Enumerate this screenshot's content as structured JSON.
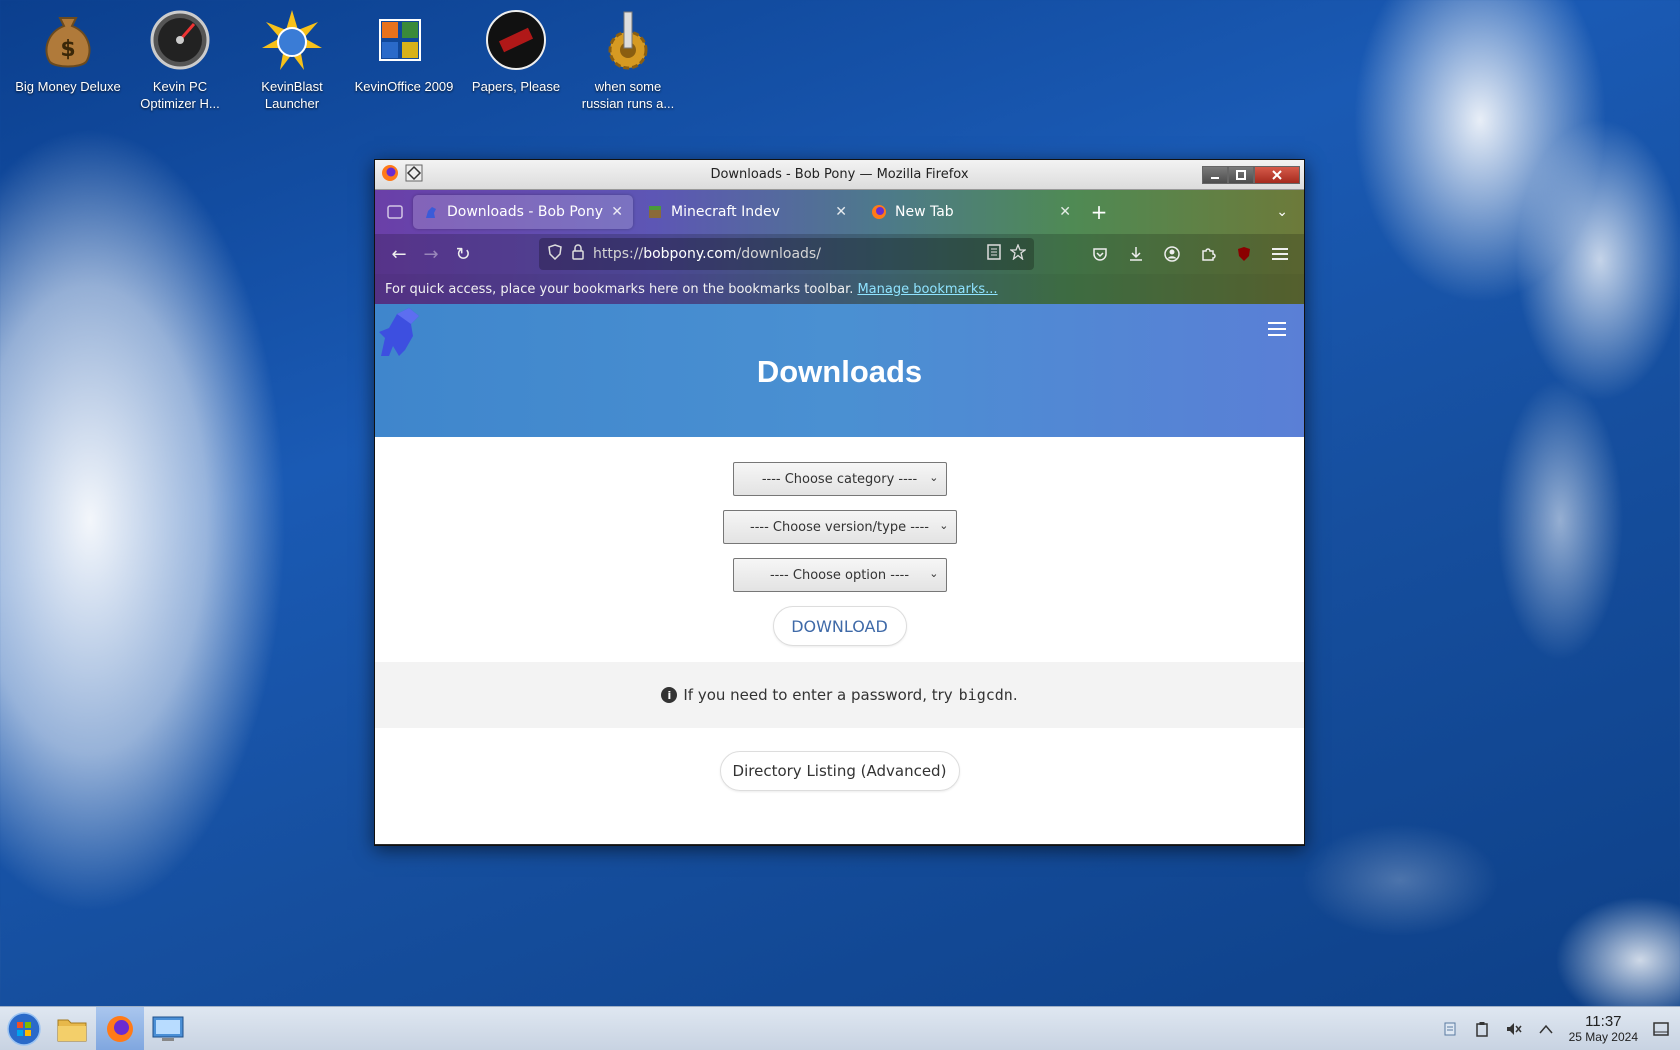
{
  "desktop": {
    "icons": [
      {
        "label": "Big Money Deluxe",
        "icon": "money-bag-icon"
      },
      {
        "label": "Kevin PC Optimizer H...",
        "icon": "speedometer-icon"
      },
      {
        "label": "KevinBlast Launcher",
        "icon": "blast-globe-icon"
      },
      {
        "label": "KevinOffice 2009",
        "icon": "office-icon"
      },
      {
        "label": "Papers, Please",
        "icon": "papers-please-icon"
      },
      {
        "label": "when some russian runs a...",
        "icon": "gear-icon"
      }
    ]
  },
  "window": {
    "title": "Downloads - Bob Pony — Mozilla Firefox",
    "tabs": [
      {
        "label": "Downloads - Bob Pony",
        "active": true
      },
      {
        "label": "Minecraft Indev",
        "active": false
      },
      {
        "label": "New Tab",
        "active": false
      }
    ],
    "url": {
      "prefix": "https://",
      "host": "bobpony.com",
      "path": "/downloads/"
    },
    "bookmarks_bar": {
      "message": "For quick access, place your bookmarks here on the bookmarks toolbar.",
      "link": "Manage bookmarks..."
    }
  },
  "page": {
    "heading": "Downloads",
    "selects": {
      "category": "---- Choose category ----",
      "version": "---- Choose version/type ----",
      "option": "---- Choose option ----"
    },
    "download_button": "DOWNLOAD",
    "notice": {
      "text": "If you need to enter a password, try",
      "password": "bigcdn",
      "suffix": "."
    },
    "directory_button": "Directory Listing (Advanced)"
  },
  "taskbar": {
    "time": "11:37",
    "date": "25 May 2024"
  },
  "colors": {
    "hero_accent": "#4a90d2",
    "link": "#3f6aa8"
  }
}
